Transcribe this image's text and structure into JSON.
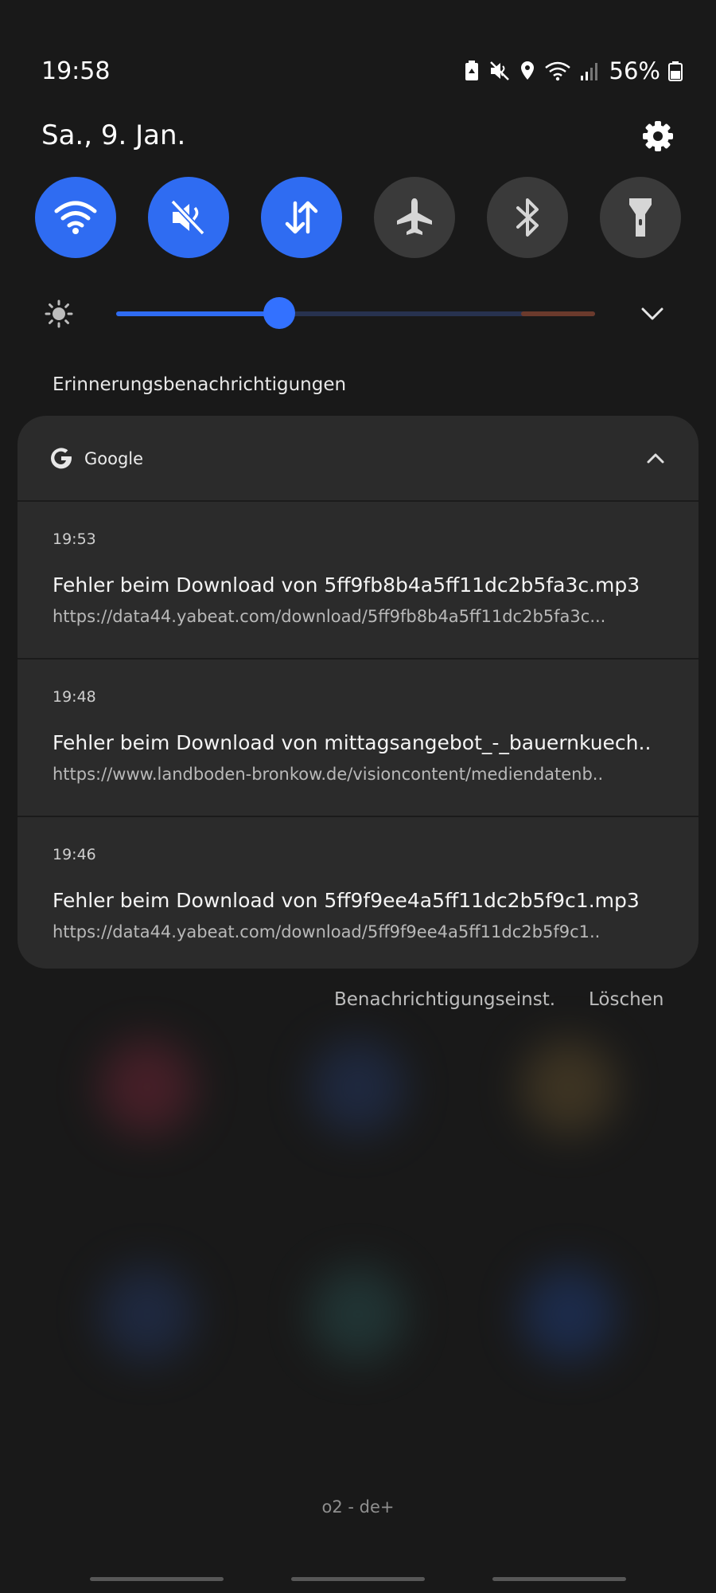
{
  "status_bar": {
    "time": "19:58",
    "battery_percent": "56%"
  },
  "header": {
    "date": "Sa., 9. Jan."
  },
  "quick_settings": {
    "tiles": [
      {
        "icon": "wifi-icon",
        "active": true
      },
      {
        "icon": "mute-icon",
        "active": true
      },
      {
        "icon": "mobile-data-icon",
        "active": true
      },
      {
        "icon": "airplane-icon",
        "active": false
      },
      {
        "icon": "bluetooth-icon",
        "active": false
      },
      {
        "icon": "flashlight-icon",
        "active": false
      }
    ],
    "brightness_level": 0.34
  },
  "notifications": {
    "section_label": "Erinnerungsbenachrichtigungen",
    "group": {
      "app_name": "Google",
      "items": [
        {
          "time": "19:53",
          "title": "Fehler beim Download von 5ff9fb8b4a5ff11dc2b5fa3c.mp3",
          "url": "https://data44.yabeat.com/download/5ff9fb8b4a5ff11dc2b5fa3c..."
        },
        {
          "time": "19:48",
          "title": "Fehler beim Download von mittagsangebot_-_bauernkuech..",
          "url": "https://www.landboden-bronkow.de/visioncontent/mediendatenb.."
        },
        {
          "time": "19:46",
          "title": "Fehler beim Download von 5ff9f9ee4a5ff11dc2b5f9c1.mp3",
          "url": "https://data44.yabeat.com/download/5ff9f9ee4a5ff11dc2b5f9c1.."
        }
      ]
    },
    "settings_action": "Benachrichtigungseinst.",
    "clear_action": "Löschen"
  },
  "footer": {
    "carrier": "o2 - de+"
  },
  "colors": {
    "accent": "#2f6cf2",
    "tile_off": "#3a3a3a",
    "card": "#2b2b2b",
    "background": "#191919"
  }
}
